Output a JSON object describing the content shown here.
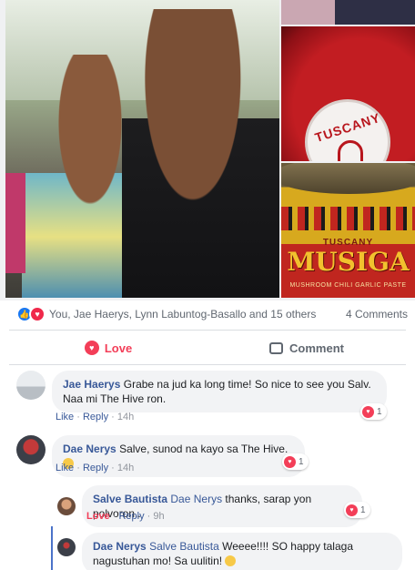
{
  "reactions": {
    "names": "You, Jae Haerys, Lynn Labuntog-Basallo and 15 others",
    "comments_count": "4 Comments"
  },
  "photos": {
    "seal_text": "TUSCANY",
    "jar_brand": "TUSCANY",
    "jar_product": "MUSIGA",
    "jar_sub": "MUSHROOM CHILI GARLIC PASTE"
  },
  "actions": {
    "love": "Love",
    "comment": "Comment"
  },
  "comments": [
    {
      "author": "Jae Haerys",
      "text": "Grabe na jud ka long time! So nice to see you Salv. Naa mi The Hive ron.",
      "like": "Like",
      "reply": "Reply",
      "time": "14h",
      "reactions": "1"
    },
    {
      "author": "Dae Nerys",
      "text": "Salve, sunod na kayo sa The Hive.",
      "like": "Like",
      "reply": "Reply",
      "time": "14h",
      "reactions": "1"
    },
    {
      "author": "Salve Bautista",
      "mention": "Dae Nerys",
      "text": "thanks, sarap yon polvoron..",
      "like": "Love",
      "reply": "Reply",
      "time": "9h",
      "reactions": "1"
    },
    {
      "author": "Dae Nerys",
      "mention": "Salve Bautista",
      "text": "Weeee!!!! SO happy talaga nagustuhan mo! Sa uulitin!"
    }
  ],
  "dot": "·",
  "colors": {
    "link": "#385898",
    "love": "#f33e58",
    "like_blue": "#1877f2"
  }
}
